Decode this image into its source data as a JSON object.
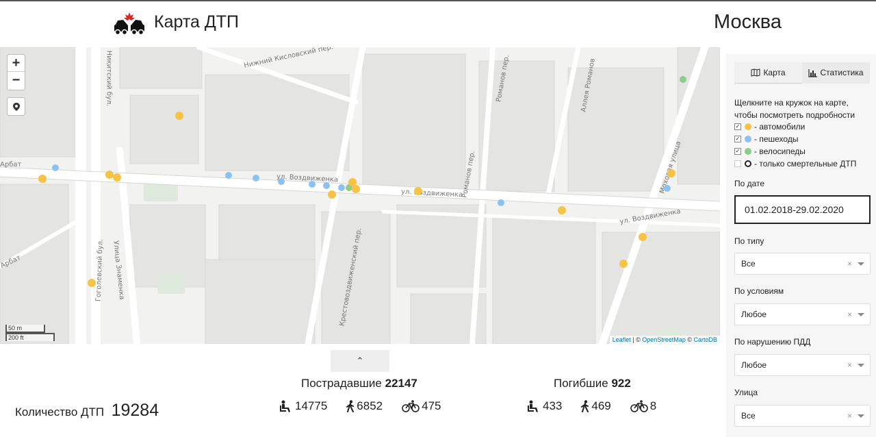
{
  "header": {
    "title": "Карта ДТП",
    "city": "Москва"
  },
  "map": {
    "zoom_in": "+",
    "zoom_out": "−",
    "scale_m": "50 m",
    "scale_ft": "200 ft",
    "attribution": {
      "leaflet": "Leaflet",
      "sep1": " | © ",
      "osm": "OpenStreetMap",
      "sep2": " © ",
      "carto": "CartoDB"
    },
    "streets": {
      "vozdvizhenka1": "ул. Воздвиженка",
      "vozdvizhenka2": "ул. Воздвиженка",
      "vozdvizhenka3": "ул. Воздвиженка",
      "arbat": "Арбат",
      "arbat2": "Арбат",
      "kislovsky": "Нижний Кисловский пер.",
      "romanov": "Романов пер.",
      "romanov2": "Романов пер.",
      "mokhovaya": "Моховая улица",
      "znamenka": "Улица Знаменка",
      "gogolevsky": "Гоголевский бул.",
      "krestovozdvizhensky": "Крестовоздвиженский пер.",
      "nikitsky": "Никитский бул.",
      "alleya": "Аллея Романов"
    },
    "accident_colors": {
      "car": "#f7c346",
      "pedestrian": "#8cc2f2",
      "bicycle": "#8ccc8c"
    }
  },
  "panel": {
    "tab_map": "Карта",
    "tab_stats": "Статистика",
    "hint": "Щелкните на кружок на карте, чтобы посмотреть подробности",
    "legend": {
      "cars": "- автомобили",
      "pedestrians": "- пешеходы",
      "bicycles": "- велосипеды",
      "fatal": "- только смертельные ДТП"
    },
    "date_label": "По дате",
    "date_value": "01.02.2018-29.02.2020",
    "type_label": "По типу",
    "type_value": "Все",
    "conditions_label": "По условиям",
    "conditions_value": "Любое",
    "violation_label": "По нарушению ПДД",
    "violation_value": "Любое",
    "street_label": "Улица",
    "street_value": "Все",
    "clear": "×"
  },
  "stats": {
    "collapse": "⌃",
    "count_label": "Количество ДТП",
    "count_value": "19284",
    "injured_label": "Пострадавшие",
    "injured_total": "22147",
    "injured_drivers": "14775",
    "injured_pedestrians": "6852",
    "injured_cyclists": "475",
    "killed_label": "Погибшие",
    "killed_total": "922",
    "killed_drivers": "433",
    "killed_pedestrians": "469",
    "killed_cyclists": "8"
  }
}
